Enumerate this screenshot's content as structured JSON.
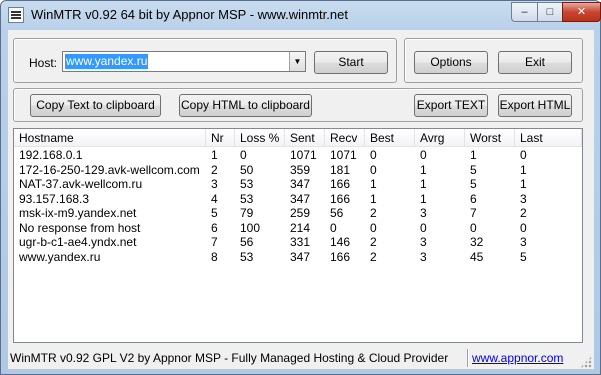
{
  "window": {
    "title": "WinMTR v0.92 64 bit by Appnor MSP - www.winmtr.net",
    "minimize_glyph": "–",
    "maximize_glyph": "□",
    "close_glyph": "✕"
  },
  "host": {
    "label": "Host:",
    "value": "www.yandex.ru",
    "dropdown_glyph": "▼"
  },
  "buttons": {
    "start": "Start",
    "options": "Options",
    "exit": "Exit",
    "copy_text": "Copy Text to clipboard",
    "copy_html": "Copy HTML to clipboard",
    "export_text": "Export TEXT",
    "export_html": "Export HTML"
  },
  "table": {
    "columns": [
      "Hostname",
      "Nr",
      "Loss %",
      "Sent",
      "Recv",
      "Best",
      "Avrg",
      "Worst",
      "Last"
    ],
    "rows": [
      [
        "192.168.0.1",
        "1",
        "0",
        "1071",
        "1071",
        "0",
        "0",
        "1",
        "0"
      ],
      [
        "172-16-250-129.avk-wellcom.com",
        "2",
        "50",
        "359",
        "181",
        "0",
        "1",
        "5",
        "1"
      ],
      [
        "NAT-37.avk-wellcom.ru",
        "3",
        "53",
        "347",
        "166",
        "1",
        "1",
        "5",
        "1"
      ],
      [
        "93.157.168.3",
        "4",
        "53",
        "347",
        "166",
        "1",
        "1",
        "6",
        "3"
      ],
      [
        "msk-ix-m9.yandex.net",
        "5",
        "79",
        "259",
        "56",
        "2",
        "3",
        "7",
        "2"
      ],
      [
        "No response from host",
        "6",
        "100",
        "214",
        "0",
        "0",
        "0",
        "0",
        "0"
      ],
      [
        "ugr-b-c1-ae4.yndx.net",
        "7",
        "56",
        "331",
        "146",
        "2",
        "3",
        "32",
        "3"
      ],
      [
        "www.yandex.ru",
        "8",
        "53",
        "347",
        "166",
        "2",
        "3",
        "45",
        "5"
      ]
    ]
  },
  "status": {
    "text": "WinMTR v0.92 GPL V2 by Appnor MSP - Fully Managed Hosting & Cloud Provider",
    "link": "www.appnor.com"
  },
  "colors": {
    "selection": "#3399ff",
    "link": "#0000ee",
    "close_button": "#c9452f"
  }
}
